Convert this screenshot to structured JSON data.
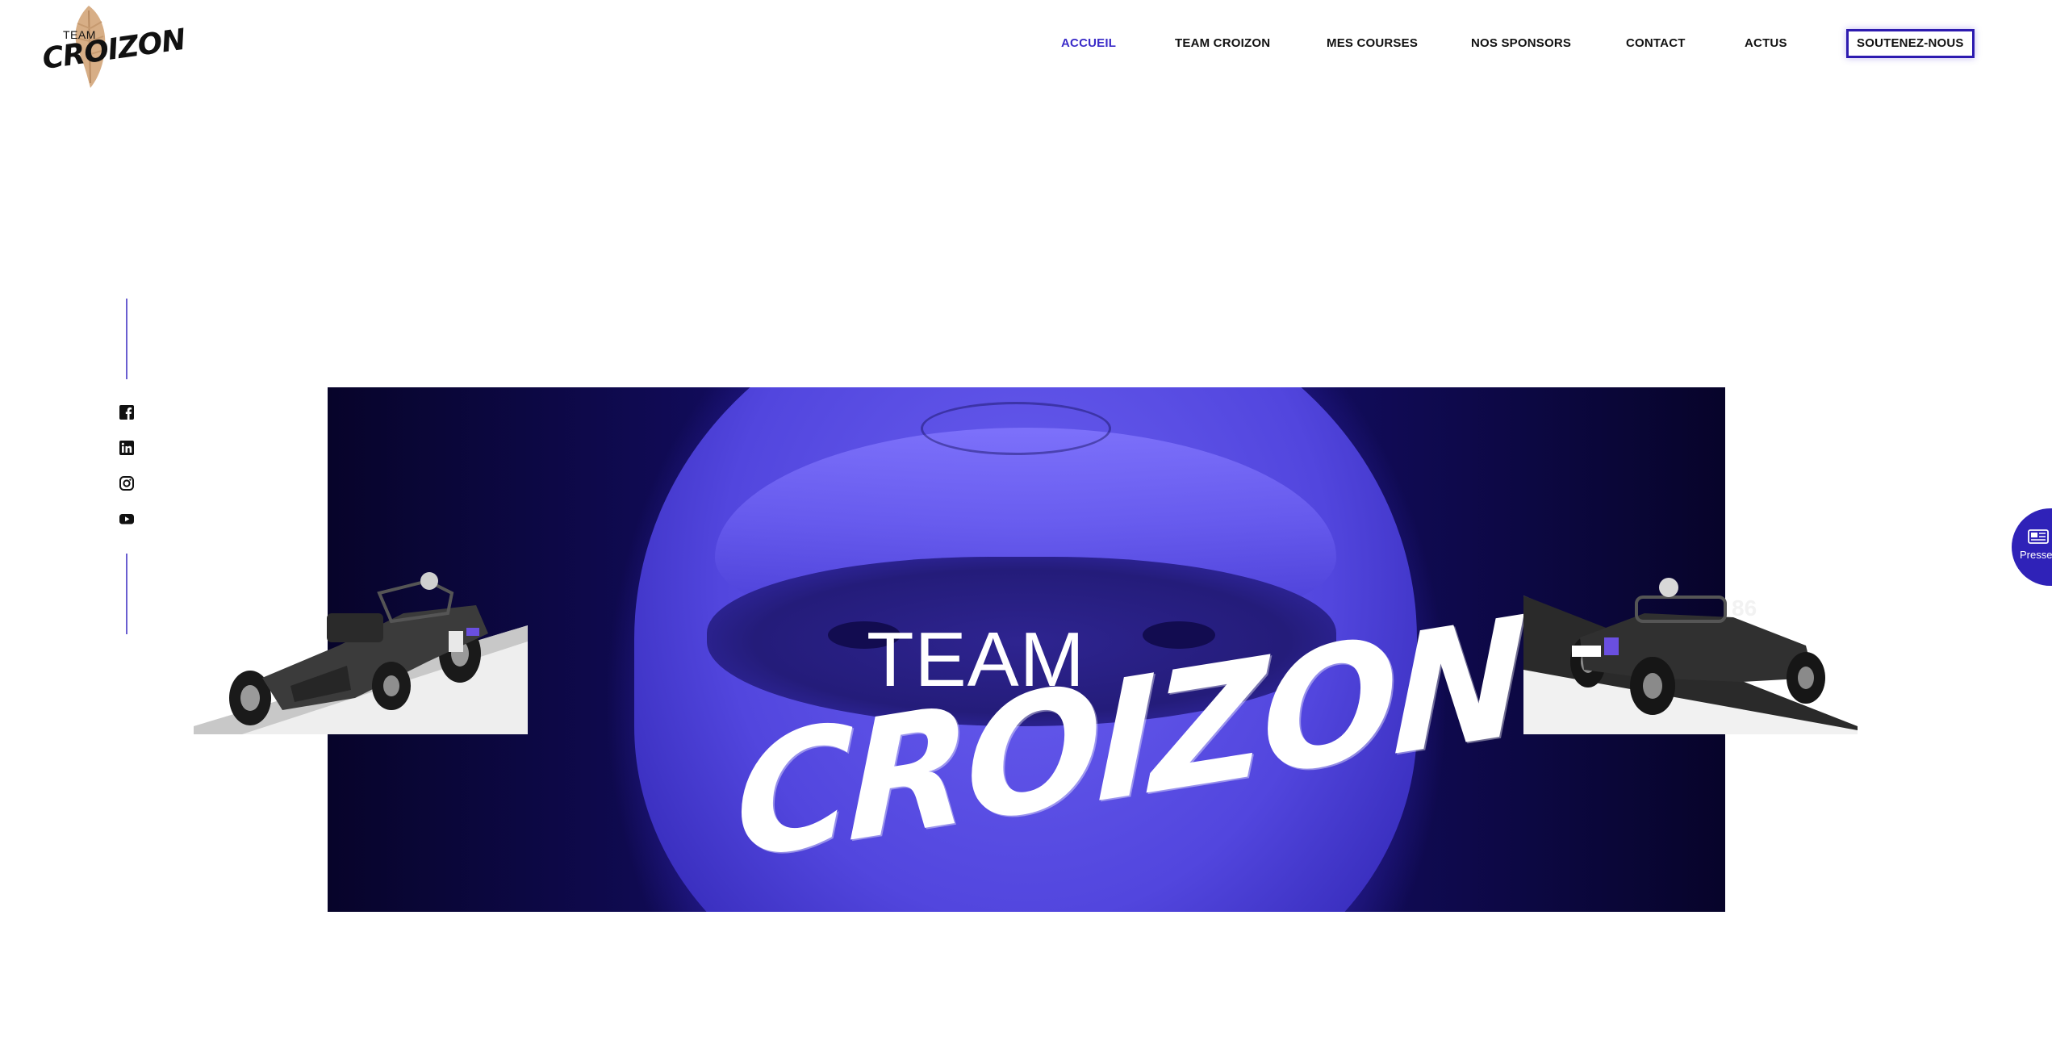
{
  "header": {
    "logo": {
      "team_text": "TEAM",
      "croizon_text": "CROIZON"
    },
    "nav": [
      {
        "label": "ACCUEIL",
        "active": true
      },
      {
        "label": "TEAM CROIZON",
        "active": false
      },
      {
        "label": "MES COURSES",
        "active": false
      },
      {
        "label": "NOS SPONSORS",
        "active": false
      },
      {
        "label": "CONTACT",
        "active": false
      },
      {
        "label": "ACTUS",
        "active": false
      },
      {
        "label": "SOUTENEZ-NOUS",
        "active": false,
        "cta": true
      }
    ]
  },
  "social": {
    "icons": [
      "facebook-icon",
      "linkedin-icon",
      "instagram-icon",
      "youtube-icon"
    ]
  },
  "hero": {
    "team_text": "TEAM",
    "croizon_text": "CROIZON",
    "car_number": "86"
  },
  "press_tab": {
    "label": "Presse",
    "icon": "newspaper-icon"
  },
  "colors": {
    "accent": "#3a2bc8",
    "cta_border": "#2d1bb0",
    "hero_purple": "#4a3dd6",
    "hero_dark": "#07042a",
    "press_bg": "#2f22b8"
  }
}
